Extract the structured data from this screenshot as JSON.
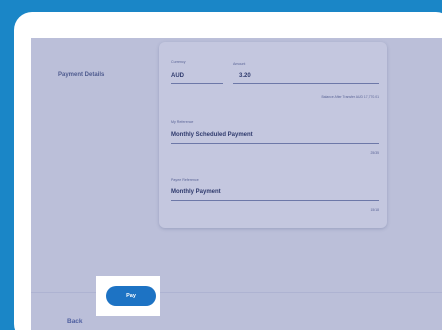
{
  "section": {
    "title": "Payment Details"
  },
  "currency": {
    "label": "Currency",
    "value": "AUD"
  },
  "amount": {
    "label": "Amount",
    "value": "3.20",
    "hint": "Balance After Transfer AUD 17,770.01"
  },
  "my_reference": {
    "label": "My Reference",
    "value": "Monthly Scheduled Payment",
    "counter": "25/35"
  },
  "payee_reference": {
    "label": "Payee Reference",
    "value": "Monthly Payment",
    "counter": "15/18"
  },
  "footer": {
    "back_label": "Back",
    "pay_label": "Pay"
  },
  "colors": {
    "brand_blue": "#1a86c7",
    "pay_button": "#1d73c4",
    "overlay": "#bbbfd9"
  }
}
